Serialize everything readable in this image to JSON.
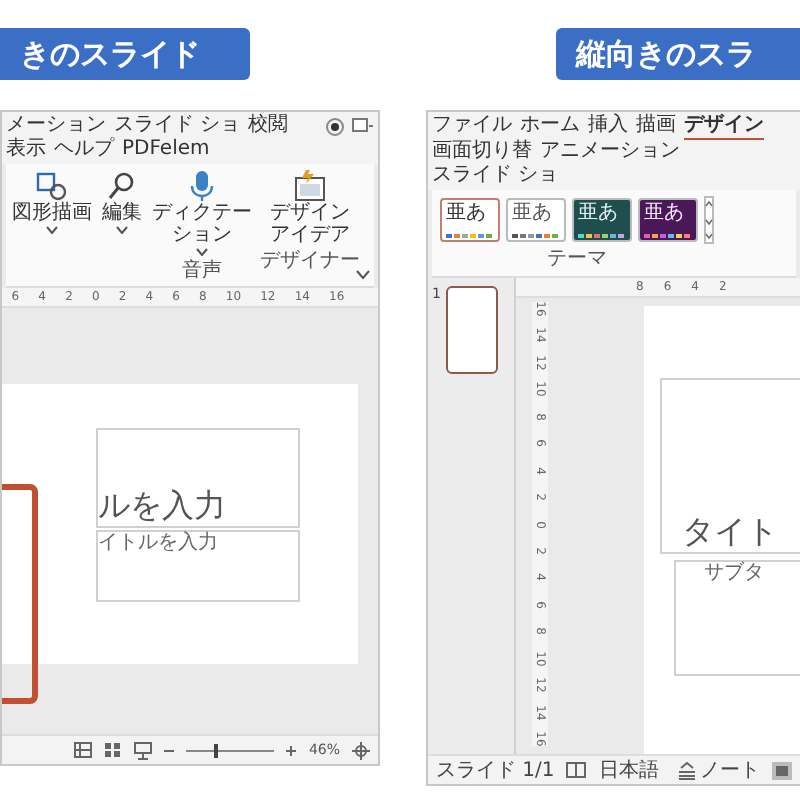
{
  "left": {
    "banner": "きのスライド",
    "tabs": [
      {
        "label": "メーション",
        "selected": false
      },
      {
        "label": "スライド ショ",
        "selected": false
      },
      {
        "label": "校閲",
        "selected": false
      },
      {
        "label": "表示",
        "selected": false
      },
      {
        "label": "ヘルプ",
        "selected": false
      },
      {
        "label": "PDFelem",
        "selected": false
      }
    ],
    "ribbon": [
      {
        "kind": "shapes",
        "lines": [
          "図形描画"
        ],
        "caret": true
      },
      {
        "kind": "find",
        "lines": [
          "編集"
        ],
        "caret": true
      },
      {
        "kind": "mic",
        "lines": [
          "ディクテー",
          "ション"
        ],
        "caret": true,
        "group": "音声"
      },
      {
        "kind": "designer",
        "lines": [
          "デザイン",
          "アイデア"
        ],
        "caret": false,
        "group": "デザイナー"
      }
    ],
    "ruler": [
      "6",
      "4",
      "2",
      "0",
      "2",
      "4",
      "6",
      "8",
      "10",
      "12",
      "14",
      "16"
    ],
    "title_text": "ルを入力",
    "subtitle_text": "イトルを入力",
    "zoom": {
      "level": 0.3,
      "reading": "46%"
    }
  },
  "right": {
    "banner": "縦向きのスラ",
    "tabs": [
      {
        "label": "ファイル",
        "selected": false
      },
      {
        "label": "ホーム",
        "selected": false
      },
      {
        "label": "挿入",
        "selected": false
      },
      {
        "label": "描画",
        "selected": false
      },
      {
        "label": "デザイン",
        "selected": true
      },
      {
        "label": "画面切り替",
        "selected": false
      },
      {
        "label": "アニメーション",
        "selected": false
      },
      {
        "label": "スライド ショ",
        "selected": false
      }
    ],
    "themes": [
      {
        "kind": "office",
        "label": "亜あ",
        "selected": true
      },
      {
        "kind": "plain",
        "label": "亜あ",
        "selected": false
      },
      {
        "kind": "teal",
        "label": "亜あ",
        "selected": false
      },
      {
        "kind": "purple",
        "label": "亜あ",
        "selected": false
      }
    ],
    "theme_group": "テーマ",
    "slide_number": "1",
    "hruler": [
      "8",
      "6",
      "4",
      "2"
    ],
    "vruler": [
      "16",
      "14",
      "12",
      "10",
      "8",
      "6",
      "4",
      "2",
      "0",
      "2",
      "4",
      "6",
      "8",
      "10",
      "12",
      "14",
      "16"
    ],
    "title_text": "タイト",
    "subtitle_text": "サブタ",
    "status": {
      "slide": "スライド 1/1",
      "language": "日本語",
      "notes": "ノート"
    }
  }
}
